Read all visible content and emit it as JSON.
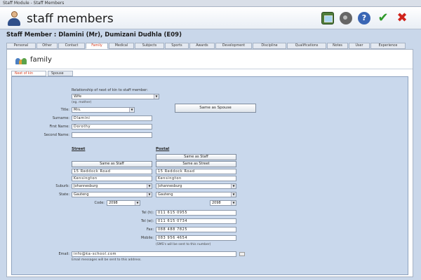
{
  "window": {
    "title": "Staff Module - Staff Members"
  },
  "header": {
    "title": "staff members",
    "icons": [
      "person-icon",
      "image-icon",
      "camera-icon",
      "help-icon",
      "checkmark-icon",
      "close-icon"
    ],
    "accent_ok": "#2f9a2a",
    "accent_close": "#d0231b"
  },
  "member": {
    "heading": "Staff Member : Dlamini (Mr), Dumizani Dudhla (E09)"
  },
  "tabs": {
    "items": [
      "Personal",
      "Other",
      "Contact",
      "Family",
      "Medical",
      "Subjects",
      "Sports",
      "Awards",
      "Development",
      "Discipline",
      "Qualifications",
      "Notes",
      "User",
      "Experience"
    ],
    "active": "Family",
    "active_color": "#d2391c"
  },
  "section": {
    "title": "family"
  },
  "subtabs": {
    "items": [
      "Next of kin",
      "Spouse"
    ],
    "active": "Next of kin"
  },
  "form": {
    "relationship_label": "Relationship of next of kin to staff member:",
    "relationship_value": "Wife",
    "relationship_hint": "(eg. mother)",
    "same_as_spouse": "Same as Spouse",
    "title_label": "Title:",
    "title_value": "Mrs.",
    "surname_label": "Surname:",
    "surname_value": "Dlamini",
    "first_name_label": "First Name:",
    "first_name_value": "Dorothy",
    "second_name_label": "Second Name:",
    "second_name_value": "",
    "street": {
      "heading": "Street",
      "same_as_staff": "Same as Staff",
      "line1": "15 Reddock Road",
      "line2": "Kensington",
      "suburb_label": "Suburb:",
      "suburb": "Johannesburg",
      "state_label": "State:",
      "state": "Gauteng",
      "code_label": "Code:",
      "code": "2098"
    },
    "postal": {
      "heading": "Postal",
      "same_as_staff": "Same as Staff",
      "same_as_street": "Same as Street",
      "line1": "15 Reddock Road",
      "line2": "Kensington",
      "suburb": "Johannesburg",
      "state": "Gauteng",
      "code": "2098"
    },
    "tel_h_label": "Tel (h):",
    "tel_h": "011 615 0955",
    "tel_w_label": "Tel (w):",
    "tel_w": "011 615 0734",
    "fax_label": "Fax:",
    "fax": "088 488 7825",
    "mobile_label": "Mobile:",
    "mobile": "083 956 4654",
    "sms_note": "(SMS's will be sent to this number)",
    "email_label": "Email:",
    "email": "info@ka-school.com",
    "email_note": "Email messages will be sent to this address."
  }
}
